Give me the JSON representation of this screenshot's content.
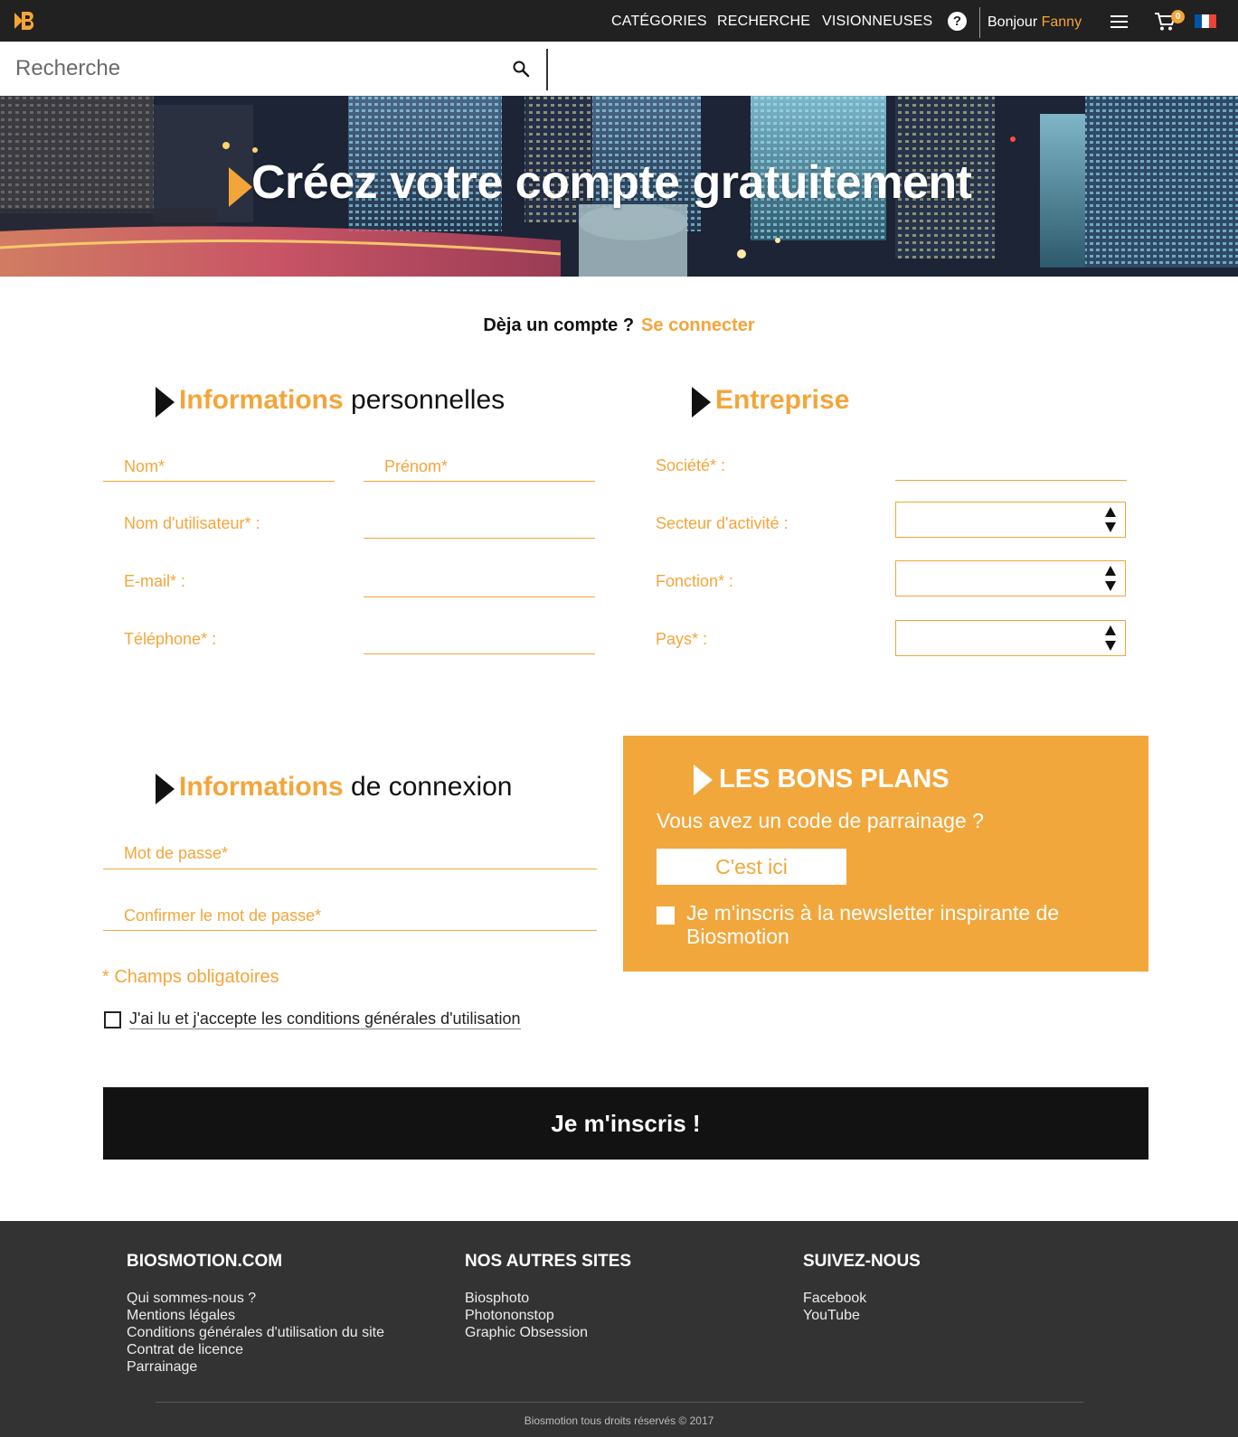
{
  "header": {
    "nav": [
      "CATÉGORIES",
      "RECHERCHE",
      "VISIONNEUSES"
    ],
    "help_label": "?",
    "greeting": "Bonjour",
    "user_name": "Fanny",
    "cart_count": "0",
    "flag_colors": [
      "#0055a4",
      "#ffffff",
      "#ef4135"
    ],
    "icons": [
      "logo-icon",
      "help-icon",
      "menu-icon",
      "cart-icon",
      "flag-fr-icon"
    ]
  },
  "search": {
    "placeholder": "Recherche",
    "icon": "search-icon"
  },
  "hero": {
    "title": "Créez votre compte gratuitement"
  },
  "account": {
    "question": "Dèja un compte ?",
    "login_link": "Se connecter"
  },
  "personal": {
    "title_highlight": "Informations",
    "title_rest": "personnelles",
    "nom": "Nom*",
    "prenom": "Prénom*",
    "username": "Nom d'utilisateur* :",
    "email": "E-mail* :",
    "phone": "Téléphone* :"
  },
  "company": {
    "title": "Entreprise",
    "societe": "Société* :",
    "secteur": "Secteur d'activité :",
    "fonction": "Fonction* :",
    "pays": "Pays* :"
  },
  "login_info": {
    "title_highlight": "Informations",
    "title_rest": "de connexion",
    "password": "Mot de passe*",
    "confirm": "Confirmer le mot de passe*"
  },
  "plans": {
    "title": "LES BONS PLANS",
    "question": "Vous avez un code de parrainage ?",
    "button": "C'est ici",
    "newsletter": "Je m'inscris à la newsletter inspirante de Biosmotion"
  },
  "required_note": "* Champs obligatoires",
  "cgu": "J'ai lu et j'accepte les conditions générales d'utilisation",
  "submit": "Je m'inscris !",
  "footer": {
    "col1": {
      "title": "BIOSMOTION.COM",
      "links": [
        "Qui sommes-nous ?",
        "Mentions légales",
        "Conditions générales d'utilisation du site",
        "Contrat de licence",
        "Parrainage"
      ]
    },
    "col2": {
      "title": "NOS AUTRES SITES",
      "links": [
        "Biosphoto",
        "Photononstop",
        "Graphic Obsession"
      ]
    },
    "col3": {
      "title": "SUIVEZ-NOUS",
      "links": [
        "Facebook",
        "YouTube"
      ]
    },
    "copyright": "Biosmotion tous droits réservés © 2017"
  },
  "colors": {
    "accent": "#f4a53a",
    "topbar": "#212121",
    "footer": "#333333",
    "button": "#121212"
  }
}
